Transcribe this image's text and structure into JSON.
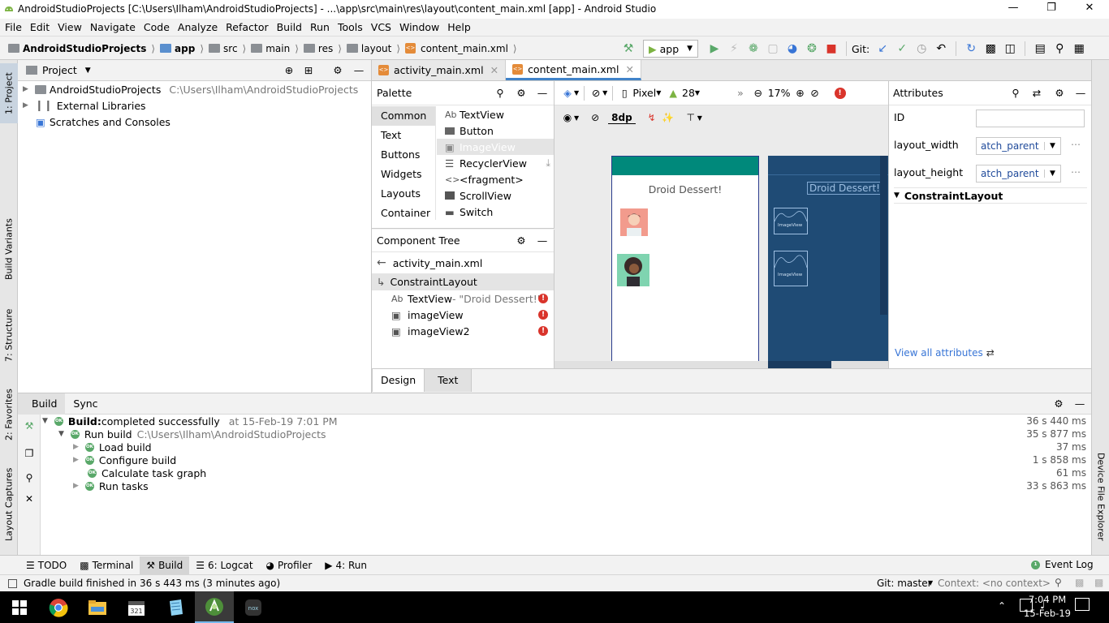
{
  "window": {
    "title": "AndroidStudioProjects [C:\\Users\\Ilham\\AndroidStudioProjects] - ...\\app\\src\\main\\res\\layout\\content_main.xml [app] - Android Studio"
  },
  "menu": [
    "File",
    "Edit",
    "View",
    "Navigate",
    "Code",
    "Analyze",
    "Refactor",
    "Build",
    "Run",
    "Tools",
    "VCS",
    "Window",
    "Help"
  ],
  "breadcrumb": [
    "AndroidStudioProjects",
    "app",
    "src",
    "main",
    "res",
    "layout",
    "content_main.xml"
  ],
  "toolbar": {
    "run_config": "app",
    "git_label": "Git:"
  },
  "left_strip": {
    "project": "1: Project",
    "build_variants": "Build Variants",
    "structure": "7: Structure",
    "favorites": "2: Favorites",
    "layout_captures": "Layout Captures"
  },
  "right_strip": {
    "device_file_explorer": "Device File Explorer"
  },
  "project_panel": {
    "title": "Project",
    "items": [
      {
        "label": "AndroidStudioProjects",
        "path": "C:\\Users\\Ilham\\AndroidStudioProjects"
      },
      {
        "label": "External Libraries"
      },
      {
        "label": "Scratches and Consoles"
      }
    ]
  },
  "editor_tabs": [
    {
      "label": "activity_main.xml"
    },
    {
      "label": "content_main.xml"
    }
  ],
  "palette": {
    "title": "Palette",
    "categories": [
      "Common",
      "Text",
      "Buttons",
      "Widgets",
      "Layouts",
      "Container"
    ],
    "items": [
      {
        "icon": "Ab",
        "label": "TextView"
      },
      {
        "icon": "button",
        "label": "Button"
      },
      {
        "icon": "image",
        "label": "ImageView"
      },
      {
        "icon": "list",
        "label": "RecyclerView"
      },
      {
        "icon": "<>",
        "label": "<fragment>"
      },
      {
        "icon": "scroll",
        "label": "ScrollView"
      },
      {
        "icon": "switch",
        "label": "Switch"
      }
    ]
  },
  "component_tree": {
    "title": "Component Tree",
    "parent": "activity_main.xml",
    "root": "ConstraintLayout",
    "children": [
      {
        "icon": "Ab",
        "label": "TextView",
        "note": "- \"Droid Dessert!\""
      },
      {
        "label": "imageView"
      },
      {
        "label": "imageView2"
      }
    ]
  },
  "design_toolbar": {
    "device": "Pixel",
    "api": "28",
    "zoom": "17%",
    "margin": "8dp"
  },
  "design_preview": {
    "title_text": "Droid Dessert!",
    "blueprint_title": "Droid Dessert!",
    "blueprint_image_label": "ImageView"
  },
  "attributes": {
    "title": "Attributes",
    "id_label": "ID",
    "width_label": "layout_width",
    "width_value": "atch_parent",
    "height_label": "layout_height",
    "height_value": "atch_parent",
    "section": "ConstraintLayout",
    "view_all": "View all attributes"
  },
  "design_tabs": [
    "Design",
    "Text"
  ],
  "build_panel": {
    "tabs": [
      "Build",
      "Sync"
    ],
    "rows": [
      {
        "bold": "Build:",
        "text": " completed successfully",
        "extra": "at 15-Feb-19 7:01 PM",
        "duration": "36 s 440 ms"
      },
      {
        "text": "Run build",
        "extra": "C:\\Users\\Ilham\\AndroidStudioProjects",
        "duration": "35 s 877 ms"
      },
      {
        "text": "Load build",
        "duration": "37 ms"
      },
      {
        "text": "Configure build",
        "duration": "1 s 858 ms"
      },
      {
        "text": "Calculate task graph",
        "duration": "61 ms"
      },
      {
        "text": "Run tasks",
        "duration": "33 s 863 ms"
      }
    ],
    "ok_badge": "OK"
  },
  "bottom_tools": [
    "TODO",
    "Terminal",
    "Build",
    "6: Logcat",
    "Profiler",
    "4: Run"
  ],
  "event_log": "Event Log",
  "status": {
    "message": "Gradle build finished in 36 s 443 ms (3 minutes ago)",
    "git": "Git: master",
    "context": "Context: <no context>"
  },
  "taskbar": {
    "time": "7:04 PM",
    "date": "15-Feb-19"
  },
  "colors": {
    "teal": "#00897b",
    "blueprint": "#1f4b75",
    "accent": "#4083c9",
    "ok": "#59a869",
    "error": "#d9342b"
  }
}
